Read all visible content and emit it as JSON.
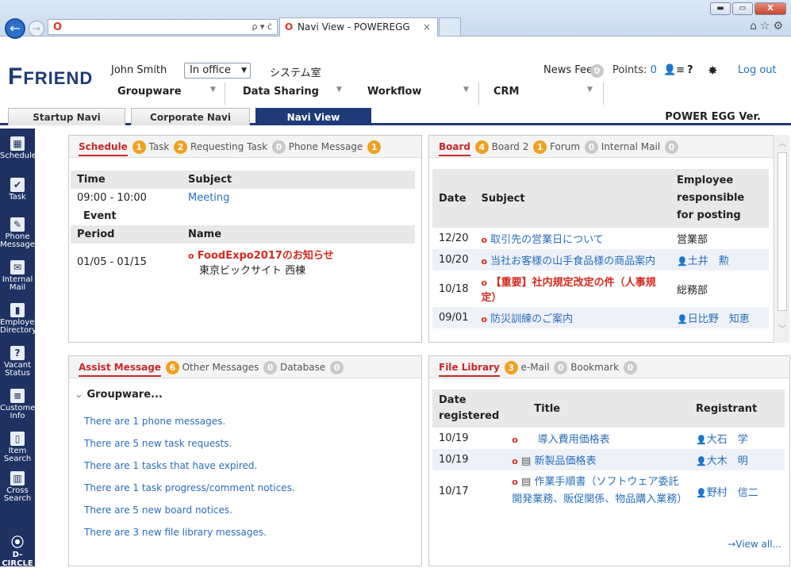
{
  "browser": {
    "address_icon": "power-egg-logo",
    "address_tools": "ρ ▾ ċ",
    "tab_title": "Navi View - POWEREGG",
    "tab_close": "×",
    "win_min": "▬",
    "win_max": "▭",
    "win_close": "X",
    "ie_icons": "⌂☆⚙"
  },
  "app": {
    "logo": "FRIEND",
    "user": "John Smith",
    "status": "In office",
    "department": "システム室",
    "news_feed": "News Feed",
    "news_feed_count": "0",
    "points": "Points:",
    "points_value": "0",
    "logout": "Log out",
    "help": "?",
    "version": "POWER EGG Ver."
  },
  "menu": [
    "Groupware",
    "Data Sharing",
    "Workflow",
    "CRM"
  ],
  "tabs": [
    "Startup Navi",
    "Corporate Navi",
    "Navi View"
  ],
  "sidebar": [
    {
      "label": "Schedule",
      "icon": "calendar-icon"
    },
    {
      "label": "Task",
      "icon": "check-icon"
    },
    {
      "label": "Phone\nMessage",
      "icon": "phone-icon"
    },
    {
      "label": "Internal\nMail",
      "icon": "mail-icon"
    },
    {
      "label": "Employee\nDirectory",
      "icon": "person-icon"
    },
    {
      "label": "Vacant\nStatus",
      "icon": "vacant-icon"
    },
    {
      "label": "Customer\nInfo",
      "icon": "customer-icon"
    },
    {
      "label": "Item\nSearch",
      "icon": "item-search-icon"
    },
    {
      "label": "Cross\nSearch",
      "icon": "cross-search-icon"
    }
  ],
  "sidebar_brand": "D-CIRCLE",
  "schedule_panel": {
    "tabs": [
      {
        "label": "Schedule",
        "count": "1"
      },
      {
        "label": "Task",
        "count": "2"
      },
      {
        "label": "Requesting Task",
        "count": "0"
      },
      {
        "label": "Phone Message",
        "count": "1"
      }
    ],
    "headers": [
      "Time",
      "Subject"
    ],
    "rows": [
      {
        "time": "09:00 - 10:00",
        "subject": "Meeting"
      }
    ],
    "event_label": "Event",
    "event_headers": [
      "Period",
      "Name"
    ],
    "events": [
      {
        "period": "01/05 - 01/15",
        "name": "FoodExpo2017のお知らせ",
        "place": "東京ビックサイト 西棟"
      }
    ]
  },
  "board_panel": {
    "tabs": [
      {
        "label": "Board",
        "count": "4"
      },
      {
        "label": "Board 2",
        "count": "1"
      },
      {
        "label": "Forum",
        "count": "0"
      },
      {
        "label": "Internal Mail",
        "count": "0"
      }
    ],
    "headers": [
      "Date",
      "Subject",
      "Employee responsible for posting"
    ],
    "rows": [
      {
        "date": "12/20",
        "subject": "取引先の営業日について",
        "poster": "営業部"
      },
      {
        "date": "10/20",
        "subject": "当社お客様の山手食品様の商品案内",
        "poster": "土井　勲"
      },
      {
        "date": "10/18",
        "subject": "【重要】社内規定改定の件（人事規定）",
        "poster": "総務部"
      },
      {
        "date": "09/01",
        "subject": "防災訓練のご案内",
        "poster": "日比野　知恵"
      }
    ]
  },
  "assist_panel": {
    "tabs": [
      {
        "label": "Assist Message",
        "count": "6"
      },
      {
        "label": "Other Messages",
        "count": "0"
      },
      {
        "label": "Database",
        "count": "0"
      }
    ],
    "group": "Groupware...",
    "messages": [
      "There are 1 phone messages.",
      "There are 5 new task requests.",
      "There are 1 tasks that have expired.",
      "There are 1 task progress/comment notices.",
      "There are 5 new board notices.",
      "There are 3 new file library messages."
    ]
  },
  "file_panel": {
    "tabs": [
      {
        "label": "File Library",
        "count": "3"
      },
      {
        "label": "e-Mail",
        "count": "0"
      },
      {
        "label": "Bookmark",
        "count": "0"
      }
    ],
    "headers": [
      "Date registered",
      "Title",
      "Registrant"
    ],
    "rows": [
      {
        "date": "10/19",
        "title": "導入費用価格表",
        "registrant": "大石　学"
      },
      {
        "date": "10/19",
        "title": "新製品価格表",
        "registrant": "大木　明"
      },
      {
        "date": "10/17",
        "title": "作業手順書（ソフトウェア委託開発業務、販促関係、物品購入業務）",
        "registrant": "野村　信二"
      }
    ],
    "view_all": "→View all..."
  }
}
